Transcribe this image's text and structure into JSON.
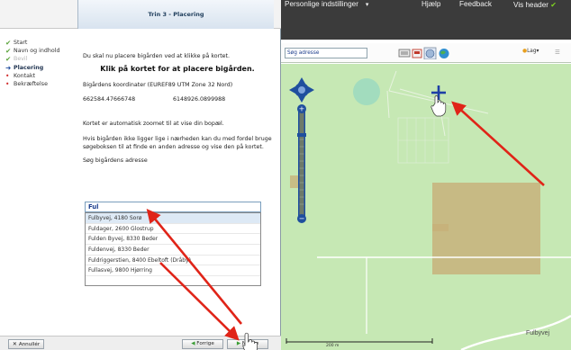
{
  "left_panel": {
    "header_title": "Trin 3 - Placering",
    "steps": [
      {
        "label": "Start",
        "status": "done"
      },
      {
        "label": "Navn og indhold",
        "status": "done"
      },
      {
        "label": "Bevil",
        "status": "gray"
      },
      {
        "label": "Placering",
        "status": "active"
      },
      {
        "label": "Kontakt",
        "status": "todo"
      },
      {
        "label": "Bekræftelse",
        "status": "todo"
      }
    ],
    "intro": "Du skal nu placere bigården ved at klikke på kortet.",
    "instruction": "Klik på kortet for at placere bigården.",
    "coord_label": "Bigårdens koordinater (EUREF89 UTM Zone 32 Nord)",
    "coord_x": "662584.47666748",
    "coord_y": "6148926.0899988",
    "zoom_note": "Kortet er automatisk zoomet til at vise din bopæl.",
    "help_note": "Hvis bigården ikke ligger lige i nærheden kan du med fordel bruge søgeboksen til at finde en anden adresse og vise den på kortet.",
    "search_label": "Søg bigårdens adresse",
    "search_value": "Ful",
    "suggestions": [
      "Fulbyvej, 4180 Sorø",
      "Fuldager, 2600 Glostrup",
      "Fulden Byvej, 8330 Beder",
      "Fuldenvej, 8330 Beder",
      "Fuldriggerstien, 8400 Ebeltoft (Dråby)",
      "Fullasvej, 9800 Hjørring"
    ],
    "footer": {
      "cancel": "Annullér",
      "prev": "Forrige",
      "next": "Næste"
    }
  },
  "topbar": {
    "title": "Personlige indstillinger",
    "title_caret": "▾",
    "help": "Hjælp",
    "feedback": "Feedback",
    "show_header": "Vis header"
  },
  "map_toolbar": {
    "search_placeholder": "Søg adresse",
    "layers_label": "Lag▾"
  },
  "map": {
    "street_label": "Fulbyvej",
    "scale_label": "200 m"
  },
  "colors": {
    "map_bg": "#c6e8b4",
    "field": "#c7b27b",
    "annotation_arrow": "#e02418",
    "marker": "#1e3fa6"
  }
}
